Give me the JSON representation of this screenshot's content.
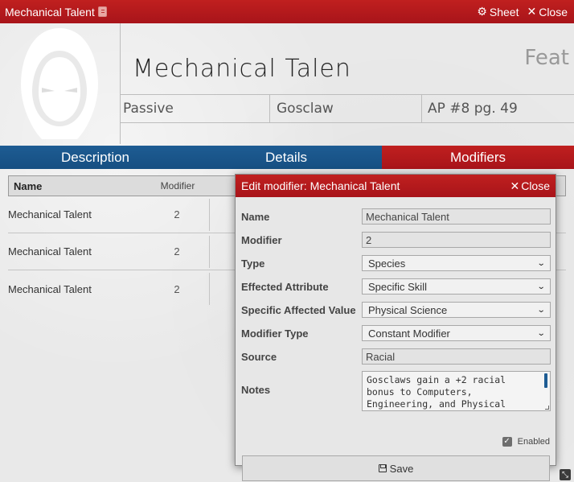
{
  "window": {
    "title": "Mechanical Talent",
    "sheet_label": "Sheet",
    "close_label": "Close"
  },
  "header": {
    "name": "Mechanical Talen",
    "type": "Feat",
    "info": [
      "Passive",
      "Gosclaw",
      "AP #8 pg. 49"
    ]
  },
  "tabs": [
    {
      "label": "Description"
    },
    {
      "label": "Details"
    },
    {
      "label": "Modifiers",
      "active": true
    }
  ],
  "modifiers_table": {
    "columns": [
      "Name",
      "Modifier"
    ],
    "rows": [
      {
        "name": "Mechanical Talent",
        "modifier": "2"
      },
      {
        "name": "Mechanical Talent",
        "modifier": "2"
      },
      {
        "name": "Mechanical Talent",
        "modifier": "2"
      }
    ]
  },
  "dialog": {
    "title": "Edit modifier: Mechanical Talent",
    "close_label": "Close",
    "fields": {
      "name": {
        "label": "Name",
        "value": "Mechanical Talent"
      },
      "modifier": {
        "label": "Modifier",
        "value": "2"
      },
      "type": {
        "label": "Type",
        "value": "Species"
      },
      "effected_attribute": {
        "label": "Effected Attribute",
        "value": "Specific Skill"
      },
      "specific_value": {
        "label": "Specific Affected Value",
        "value": "Physical Science"
      },
      "modifier_type": {
        "label": "Modifier Type",
        "value": "Constant Modifier"
      },
      "source": {
        "label": "Source",
        "value": "Racial"
      },
      "notes": {
        "label": "Notes",
        "value": "Gosclaws gain a +2 racial bonus to Computers, Engineering, and Physical"
      }
    },
    "enabled_label": "Enabled",
    "enabled": true,
    "save_label": "Save"
  },
  "colors": {
    "red": "#b01a1d",
    "blue": "#1a5589"
  }
}
